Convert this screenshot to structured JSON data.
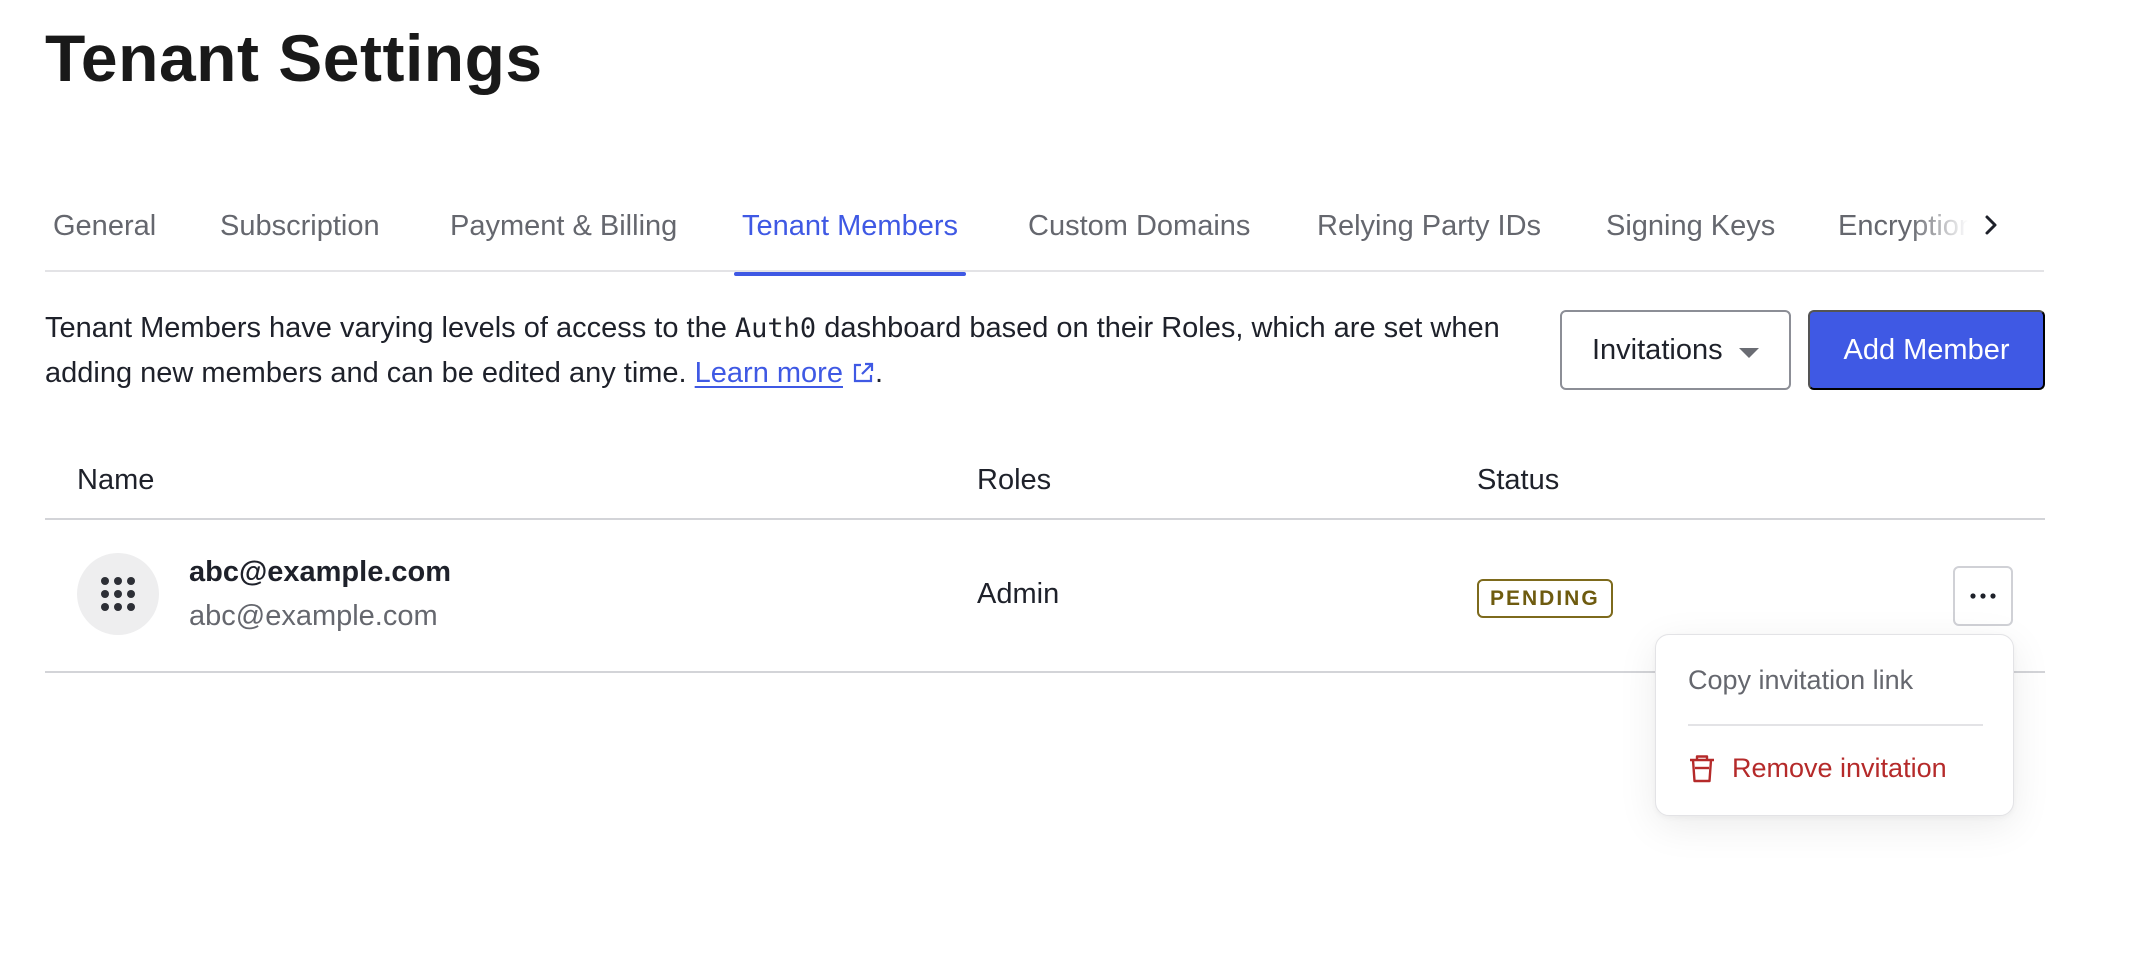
{
  "page": {
    "title": "Tenant Settings"
  },
  "tabs": [
    {
      "label": "General"
    },
    {
      "label": "Subscription"
    },
    {
      "label": "Payment & Billing"
    },
    {
      "label": "Tenant Members",
      "active": true
    },
    {
      "label": "Custom Domains"
    },
    {
      "label": "Relying Party IDs"
    },
    {
      "label": "Signing Keys"
    },
    {
      "label": "Encryption"
    }
  ],
  "description": {
    "part1": "Tenant Members have varying levels of access to the ",
    "product": "Auth0",
    "part2": " dashboard based on their Roles, which are set when adding new members and can be edited any time. ",
    "link": "Learn more",
    "end": "."
  },
  "actions": {
    "invitations_label": "Invitations",
    "add_member_label": "Add Member"
  },
  "table": {
    "headers": {
      "name": "Name",
      "roles": "Roles",
      "status": "Status"
    },
    "rows": [
      {
        "name": "abc@example.com",
        "email": "abc@example.com",
        "role": "Admin",
        "status": "PENDING"
      }
    ]
  },
  "row_menu": {
    "copy_link": "Copy invitation link",
    "remove": "Remove invitation"
  },
  "colors": {
    "accent": "#3f59e4",
    "pending": "#6e5b0f",
    "danger": "#b52a2a"
  },
  "icons": {
    "tab_scroll": "chevron-right-icon",
    "learn_more": "external-link-icon",
    "avatar": "grid-dots-icon",
    "row_actions": "more-horizontal-icon",
    "remove": "trash-icon"
  }
}
